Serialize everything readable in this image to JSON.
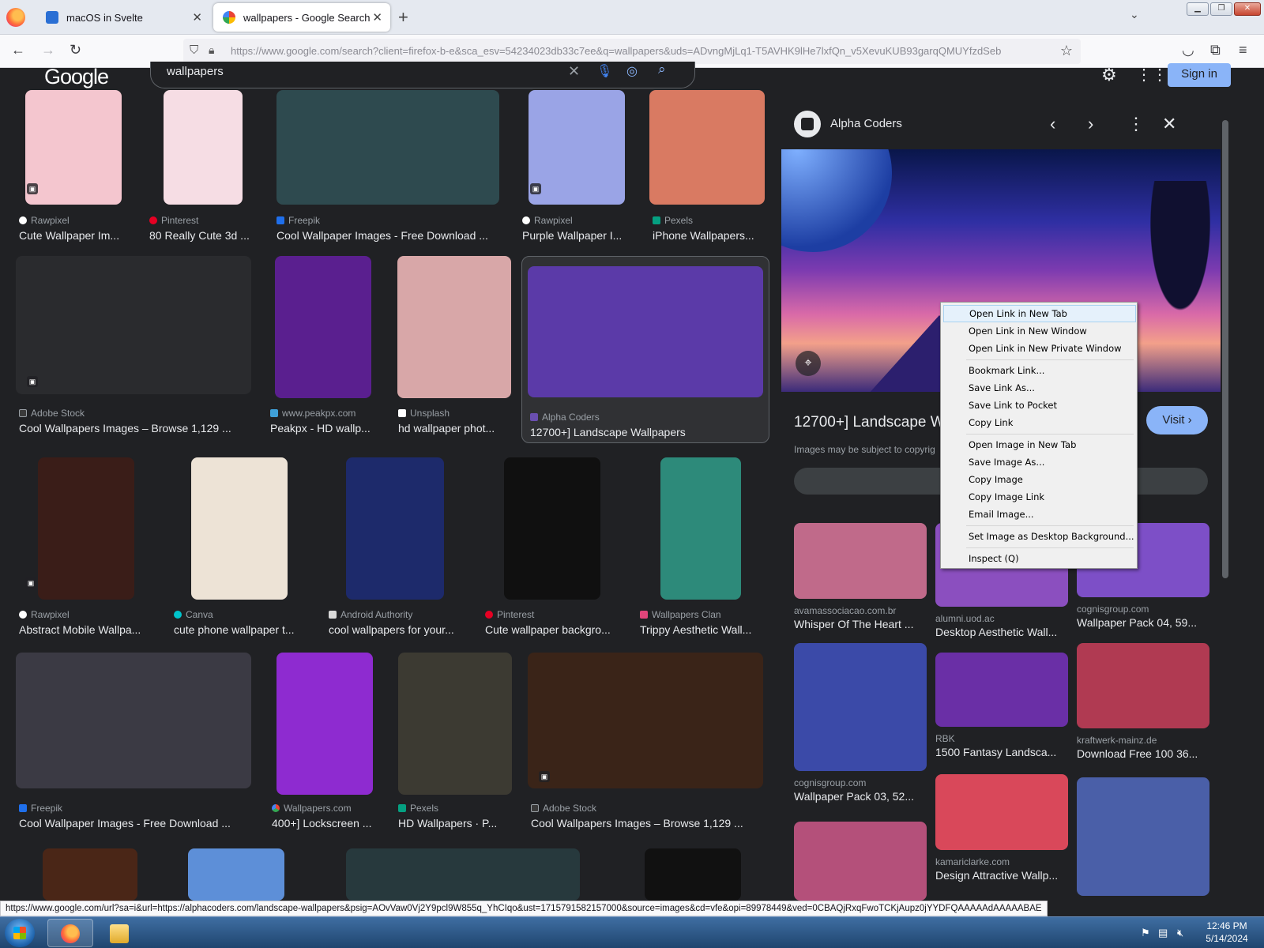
{
  "browser": {
    "tabs": [
      {
        "label": "macOS in Svelte"
      },
      {
        "label": "wallpapers - Google Search"
      }
    ],
    "url": "https://www.google.com/search?client=firefox-b-e&sca_esv=54234023db33c7ee&q=wallpapers&uds=ADvngMjLq1-T5AVHK9lHe7lxfQn_v5XevuKUB93garqQMUYfzdSeb",
    "status_url": "https://www.google.com/url?sa=i&url=https://alphacoders.com/landscape-wallpapers&psig=AOvVaw0Vj2Y9pcl9W855q_YhCIqo&ust=1715791582157000&source=images&cd=vfe&opi=89978449&ved=0CBAQjRxqFwoTCKjAupz0jYYDFQAAAAAdAAAAABAE"
  },
  "google": {
    "logo": "Google",
    "query": "wallpapers",
    "sign_in": "Sign in"
  },
  "results": [
    {
      "source": "Rawpixel",
      "title": "Cute Wallpaper Im...",
      "color": "#f4c6cf"
    },
    {
      "source": "Pinterest",
      "title": "80 Really Cute 3d ...",
      "color": "#f6dde4"
    },
    {
      "source": "Freepik",
      "title": "Cool Wallpaper Images - Free Download ...",
      "color": "#2e4a4f"
    },
    {
      "source": "Rawpixel",
      "title": "Purple Wallpaper I...",
      "color": "#9aa4e6"
    },
    {
      "source": "Pexels",
      "title": "iPhone Wallpapers...",
      "color": "#d97a62"
    },
    {
      "source": "Adobe Stock",
      "title": "Cool Wallpapers Images – Browse 1,129 ...",
      "color": "#2a2b2e"
    },
    {
      "source": "www.peakpx.com",
      "title": "Peakpx - HD wallp...",
      "color": "#5a1f8f"
    },
    {
      "source": "Unsplash",
      "title": "hd wallpaper phot...",
      "color": "#d8a7a8"
    },
    {
      "source": "Alpha Coders",
      "title": "12700+] Landscape Wallpapers",
      "color": "#5b3aa8"
    },
    {
      "source": "Rawpixel",
      "title": "Abstract Mobile Wallpa...",
      "color": "#3a1d18"
    },
    {
      "source": "Canva",
      "title": "cute phone wallpaper t...",
      "color": "#ede3d6"
    },
    {
      "source": "Android Authority",
      "title": "cool wallpapers for your...",
      "color": "#1d2a6b"
    },
    {
      "source": "Pinterest",
      "title": "Cute wallpaper backgro...",
      "color": "#101010"
    },
    {
      "source": "Wallpapers Clan",
      "title": "Trippy Aesthetic Wall...",
      "color": "#2d8a7a"
    },
    {
      "source": "Freepik",
      "title": "Cool Wallpaper Images - Free Download ...",
      "color": "#3b3a44"
    },
    {
      "source": "Wallpapers.com",
      "title": "400+] Lockscreen ...",
      "color": "#8e2bd0"
    },
    {
      "source": "Pexels",
      "title": "HD Wallpapers · P...",
      "color": "#3c3a32"
    },
    {
      "source": "Adobe Stock",
      "title": "Cool Wallpapers Images – Browse 1,129 ...",
      "color": "#3a2418"
    },
    {
      "source": "",
      "title": "",
      "color": "#4a2617"
    },
    {
      "source": "",
      "title": "",
      "color": "#5d8fd8"
    },
    {
      "source": "",
      "title": "",
      "color": "#27393d"
    },
    {
      "source": "",
      "title": "",
      "color": "#111111"
    }
  ],
  "panel": {
    "site": "Alpha Coders",
    "title": "12700+] Landscape Wa",
    "visit": "Visit",
    "copyright": "Images may be subject to copyrig",
    "related": [
      {
        "source": "avamassociacao.com.br",
        "title": "Whisper Of The Heart ...",
        "color": "#c06a8a"
      },
      {
        "source": "alumni.uod.ac",
        "title": "Desktop Aesthetic Wall...",
        "color": "#8b4fbf"
      },
      {
        "source": "cognisgroup.com",
        "title": "Wallpaper Pack 04, 59...",
        "color": "#7d4fc7"
      },
      {
        "source": "cognisgroup.com",
        "title": "Wallpaper Pack 03, 52...",
        "color": "#3b4aa8"
      },
      {
        "source": "RBK",
        "title": "1500 Fantasy Landsca...",
        "color": "#6a2fa6"
      },
      {
        "source": "kraftwerk-mainz.de",
        "title": "Download Free 100 36...",
        "color": "#b03a52"
      },
      {
        "source": "kamariclarke.com",
        "title": "Design Attractive Wallp...",
        "color": "#d9485a"
      },
      {
        "source": "",
        "title": "",
        "color": "#b4507a"
      },
      {
        "source": "",
        "title": "",
        "color": "#4a5fa8"
      }
    ]
  },
  "context_menu": [
    {
      "label": "Open Link in New Tab",
      "highlighted": true
    },
    {
      "label": "Open Link in New Window"
    },
    {
      "label": "Open Link in New Private Window"
    },
    {
      "label": "Bookmark Link..."
    },
    {
      "label": "Save Link As..."
    },
    {
      "label": "Save Link to Pocket"
    },
    {
      "label": "Copy Link"
    },
    {
      "label": "Open Image in New Tab"
    },
    {
      "label": "Save Image As..."
    },
    {
      "label": "Copy Image"
    },
    {
      "label": "Copy Image Link"
    },
    {
      "label": "Email Image..."
    },
    {
      "label": "Set Image as Desktop Background..."
    },
    {
      "label": "Inspect (Q)"
    }
  ],
  "taskbar": {
    "time": "12:46 PM",
    "date": "5/14/2024"
  }
}
